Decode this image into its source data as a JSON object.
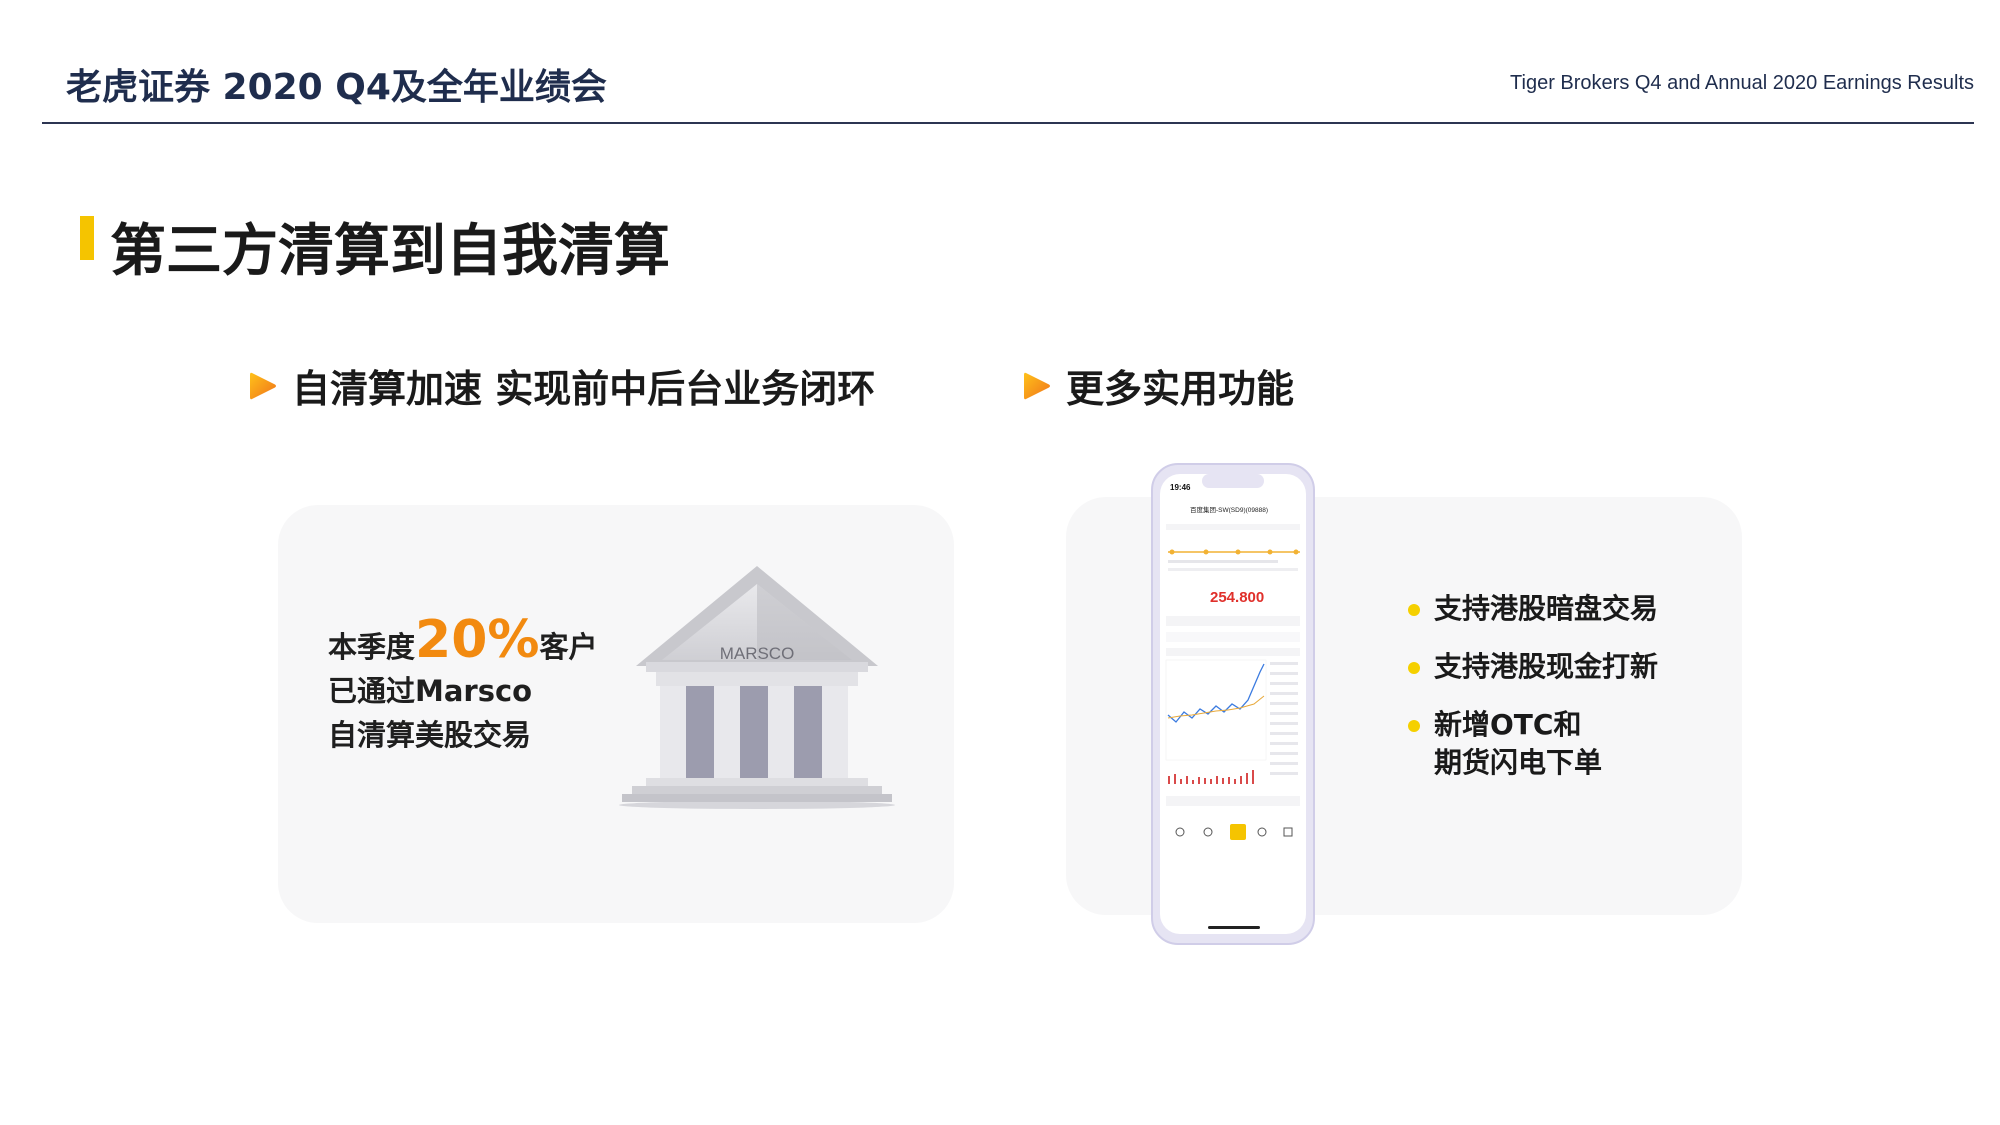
{
  "header": {
    "title_cn": "老虎证券 2020 Q4及全年业绩会",
    "title_en": "Tiger Brokers Q4 and Annual 2020 Earnings Results"
  },
  "slide": {
    "title": "第三方清算到自我清算",
    "left": {
      "heading": "自清算加速 实现前中后台业务闭环",
      "stat_prefix": "本季度",
      "stat_percent": "20%",
      "stat_suffix": "客户",
      "stat_line2": "已通过Marsco",
      "stat_line3": "自清算美股交易",
      "bank_label": "MARSCO"
    },
    "right": {
      "heading": "更多实用功能",
      "bullets": [
        {
          "line1": "支持港股暗盘交易"
        },
        {
          "line1": "支持港股现金打新"
        },
        {
          "line1": "新增OTC和",
          "line2": "期货闪电下单"
        }
      ],
      "phone": {
        "time": "19:46",
        "stock_name": "百度集团-SW(SD9)(09888)",
        "price": "254.800"
      }
    }
  },
  "colors": {
    "navy": "#1f2d4d",
    "accent_yellow": "#f5c400",
    "accent_orange": "#f28a10",
    "card_bg": "#f7f7f8"
  }
}
